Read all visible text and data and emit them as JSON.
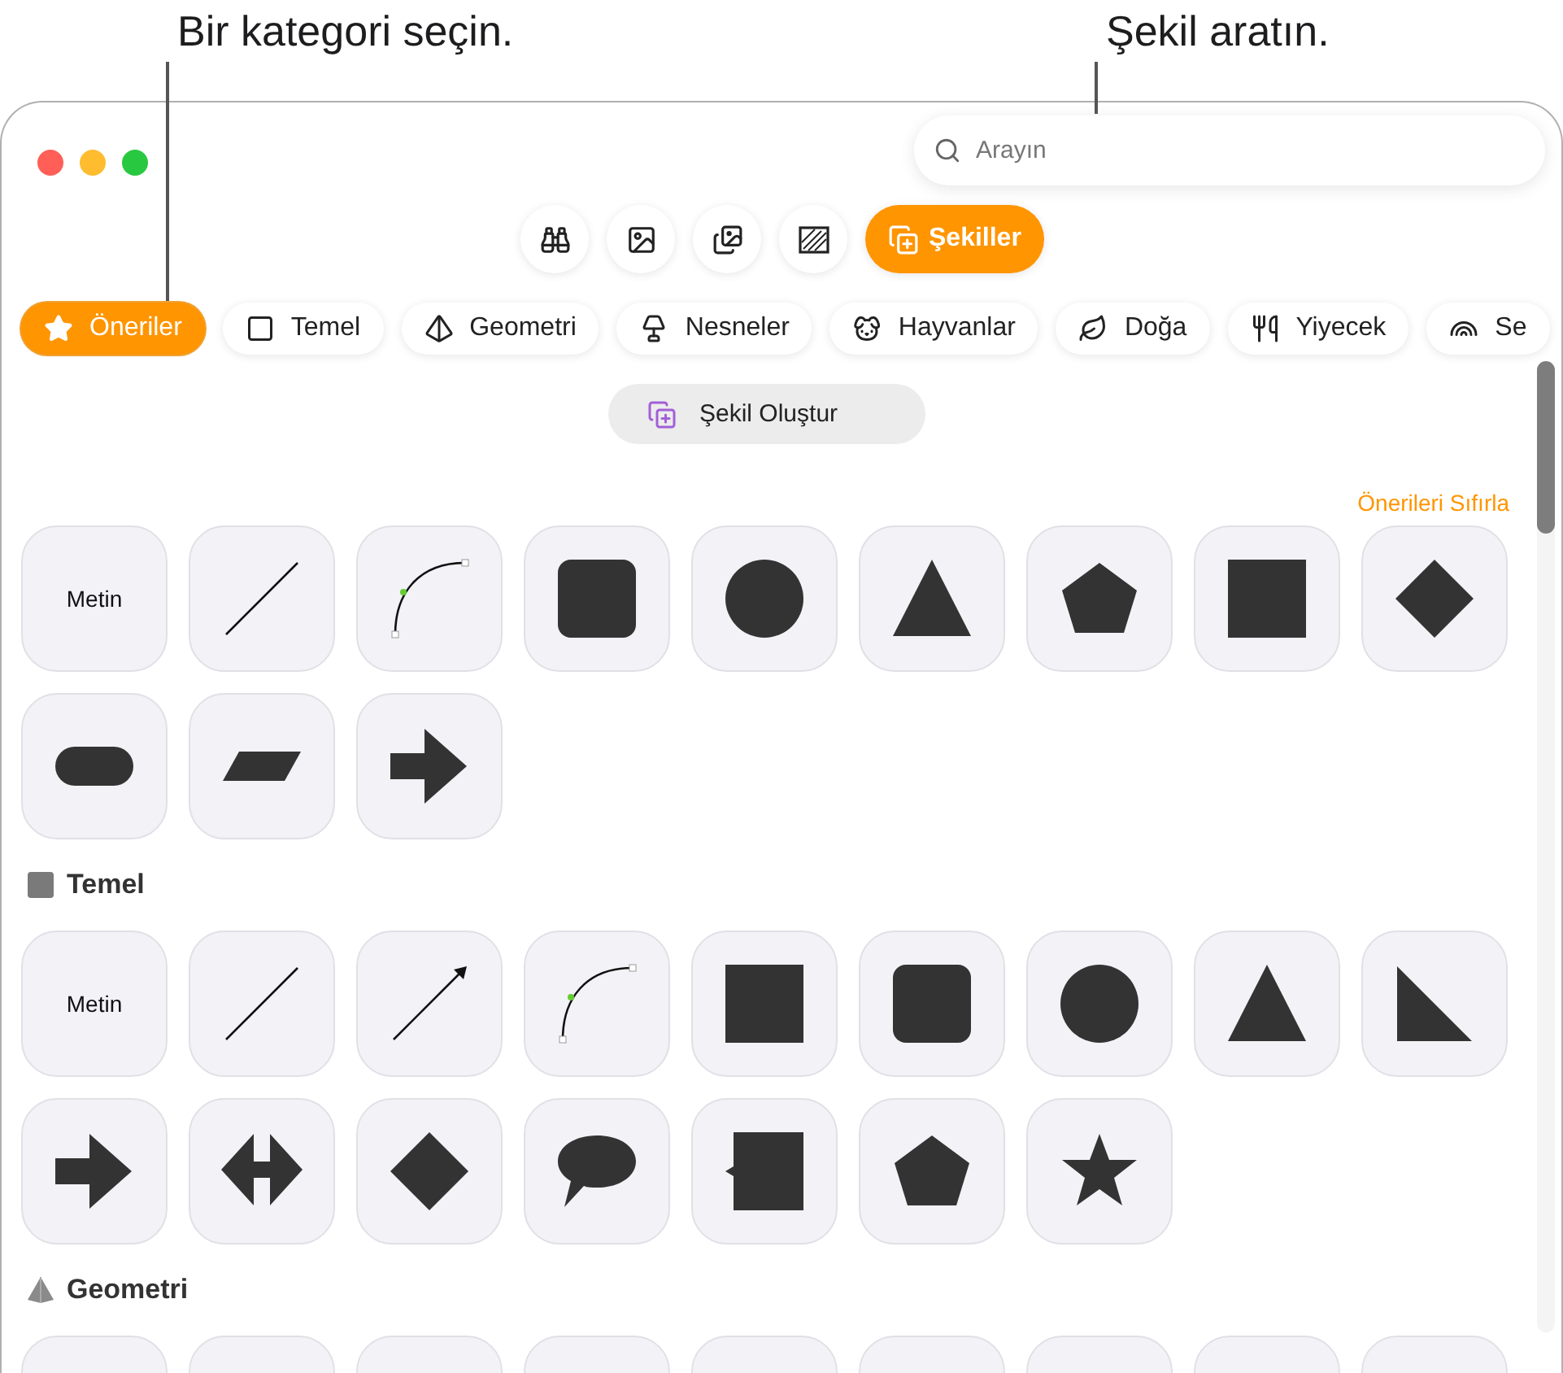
{
  "callouts": [
    {
      "text": "Bir kategori seçin."
    },
    {
      "text": "Şekil aratın."
    }
  ],
  "search": {
    "placeholder": "Arayın"
  },
  "toolbar": [
    {
      "selected": false
    },
    {
      "selected": false
    },
    {
      "selected": false
    },
    {
      "selected": false
    },
    {
      "label": "Şekiller",
      "selected": true
    }
  ],
  "categories": [
    {
      "label": "Öneriler",
      "selected": true
    },
    {
      "label": "Temel",
      "selected": false
    },
    {
      "label": "Geometri",
      "selected": false
    },
    {
      "label": "Nesneler",
      "selected": false
    },
    {
      "label": "Hayvanlar",
      "selected": false
    },
    {
      "label": "Doğa",
      "selected": false
    },
    {
      "label": "Yiyecek",
      "selected": false
    },
    {
      "label": "Se",
      "selected": false
    }
  ],
  "create_button": {
    "label": "Şekil Oluştur"
  },
  "reset_link": "Önerileri Sıfırla",
  "sections": [
    {
      "shapes": [
        {
          "kind": "text",
          "label": "Metin"
        },
        {
          "kind": "line"
        },
        {
          "kind": "curve"
        },
        {
          "kind": "rounded-square"
        },
        {
          "kind": "circle"
        },
        {
          "kind": "triangle"
        },
        {
          "kind": "pentagon"
        },
        {
          "kind": "square"
        },
        {
          "kind": "diamond"
        },
        {
          "kind": "pill"
        },
        {
          "kind": "parallelogram"
        },
        {
          "kind": "arrow"
        }
      ]
    },
    {
      "title": "Temel",
      "shapes": [
        {
          "kind": "text",
          "label": "Metin"
        },
        {
          "kind": "line"
        },
        {
          "kind": "arrow-line"
        },
        {
          "kind": "curve"
        },
        {
          "kind": "square"
        },
        {
          "kind": "rounded-square"
        },
        {
          "kind": "circle"
        },
        {
          "kind": "triangle"
        },
        {
          "kind": "right-triangle"
        },
        {
          "kind": "arrow"
        },
        {
          "kind": "double-arrow"
        },
        {
          "kind": "diamond"
        },
        {
          "kind": "speech-bubble"
        },
        {
          "kind": "callout-square"
        },
        {
          "kind": "pentagon"
        },
        {
          "kind": "star"
        }
      ]
    },
    {
      "title": "Geometri",
      "shapes": [
        {
          "kind": "partial"
        },
        {
          "kind": "partial"
        },
        {
          "kind": "partial"
        },
        {
          "kind": "partial"
        },
        {
          "kind": "partial"
        },
        {
          "kind": "partial"
        },
        {
          "kind": "partial"
        },
        {
          "kind": "partial"
        },
        {
          "kind": "partial"
        }
      ]
    }
  ]
}
